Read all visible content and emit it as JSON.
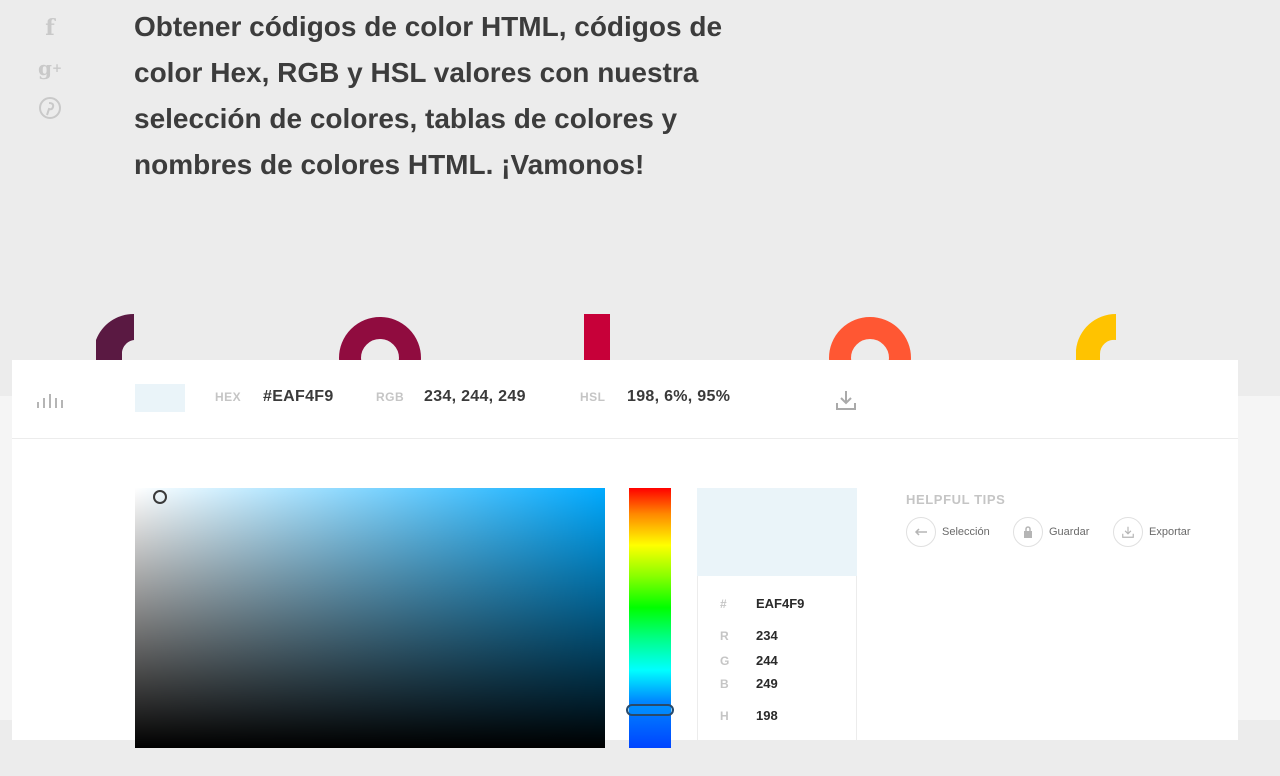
{
  "social": {
    "facebook_icon": "facebook-icon",
    "googleplus_icon": "google-plus-icon",
    "pinterest_icon": "pinterest-icon"
  },
  "hero": {
    "line1": "Obtener códigos de color HTML, códigos de",
    "line2": "color Hex, RGB y HSL valores con nuestra",
    "line3": "selección de colores, tablas de colores y",
    "line4": "nombres de colores HTML. ¡Vamonos!"
  },
  "decorations": {
    "colors": [
      "#5a1942",
      "#900c3f",
      "#c70039",
      "#ff5733",
      "#ffc300"
    ]
  },
  "toolbar": {
    "swatch_color": "#EAF4F9",
    "hex_label": "HEX",
    "hex_value": "#EAF4F9",
    "rgb_label": "RGB",
    "rgb_value": "234, 244, 249",
    "hsl_label": "HSL",
    "hsl_value": "198, 6%, 95%",
    "download_icon": "download-icon"
  },
  "picker": {
    "hue_color": "#00aaff",
    "preview_color": "#EAF4F9"
  },
  "values": {
    "hash_label": "#",
    "hex": "EAF4F9",
    "r_label": "R",
    "r": "234",
    "g_label": "G",
    "g": "244",
    "b_label": "B",
    "b": "249",
    "h_label": "H",
    "h": "198"
  },
  "tips": {
    "title": "HELPFUL TIPS",
    "items": [
      {
        "label": "Selección",
        "icon": "arrow-left-icon"
      },
      {
        "label": "Guardar",
        "icon": "lock-icon"
      },
      {
        "label": "Exportar",
        "icon": "download-icon"
      }
    ]
  }
}
